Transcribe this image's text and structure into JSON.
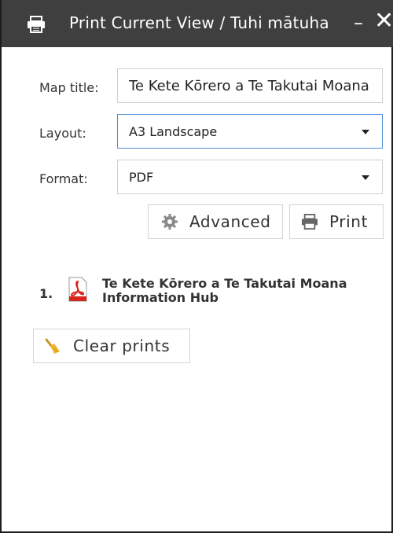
{
  "titlebar": {
    "title": "Print Current View / Tuhi mātuha",
    "minimize_label": "–",
    "close_label": "✕",
    "icon": "print-icon"
  },
  "form": {
    "map_title_label": "Map title:",
    "map_title_value": "Te Kete Kōrero a Te Takutai Moana Information Hub",
    "layout_label": "Layout:",
    "layout_value": "A3 Landscape",
    "format_label": "Format:",
    "format_value": "PDF"
  },
  "buttons": {
    "advanced_label": "Advanced",
    "advanced_icon": "gear-icon",
    "print_label": "Print",
    "print_icon": "print-icon",
    "clear_label": "Clear prints",
    "clear_icon": "broom-icon"
  },
  "results": [
    {
      "num": "1.",
      "title": "Te Kete Kōrero a Te Takutai Moana Information Hub",
      "icon": "pdf-icon"
    }
  ],
  "colors": {
    "titlebar_bg": "#3f3f3f",
    "focus_border": "#4b8cd6",
    "pdf_red": "#d9261c"
  }
}
